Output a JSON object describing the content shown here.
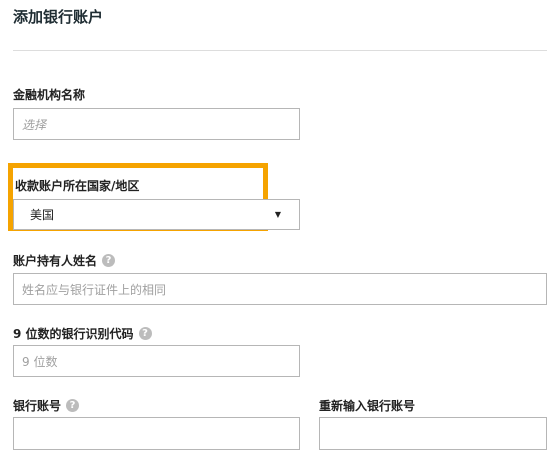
{
  "page": {
    "title": "添加银行账户"
  },
  "form": {
    "institution": {
      "label": "金融机构名称",
      "placeholder": "选择"
    },
    "country": {
      "label": "收款账户所在国家/地区",
      "value": "美国"
    },
    "holder_name": {
      "label": "账户持有人姓名",
      "placeholder": "姓名应与银行证件上的相同"
    },
    "routing_number": {
      "label": "9 位数的银行识别代码",
      "placeholder": "9 位数"
    },
    "account_number": {
      "label": "银行账号",
      "value": ""
    },
    "account_number_confirm": {
      "label": "重新输入银行账号",
      "value": ""
    }
  },
  "colors": {
    "highlight": "#f5a300",
    "help_icon": "#bcbcbc"
  },
  "icons": {
    "help": "question-mark-circle",
    "dropdown": "caret-down"
  }
}
